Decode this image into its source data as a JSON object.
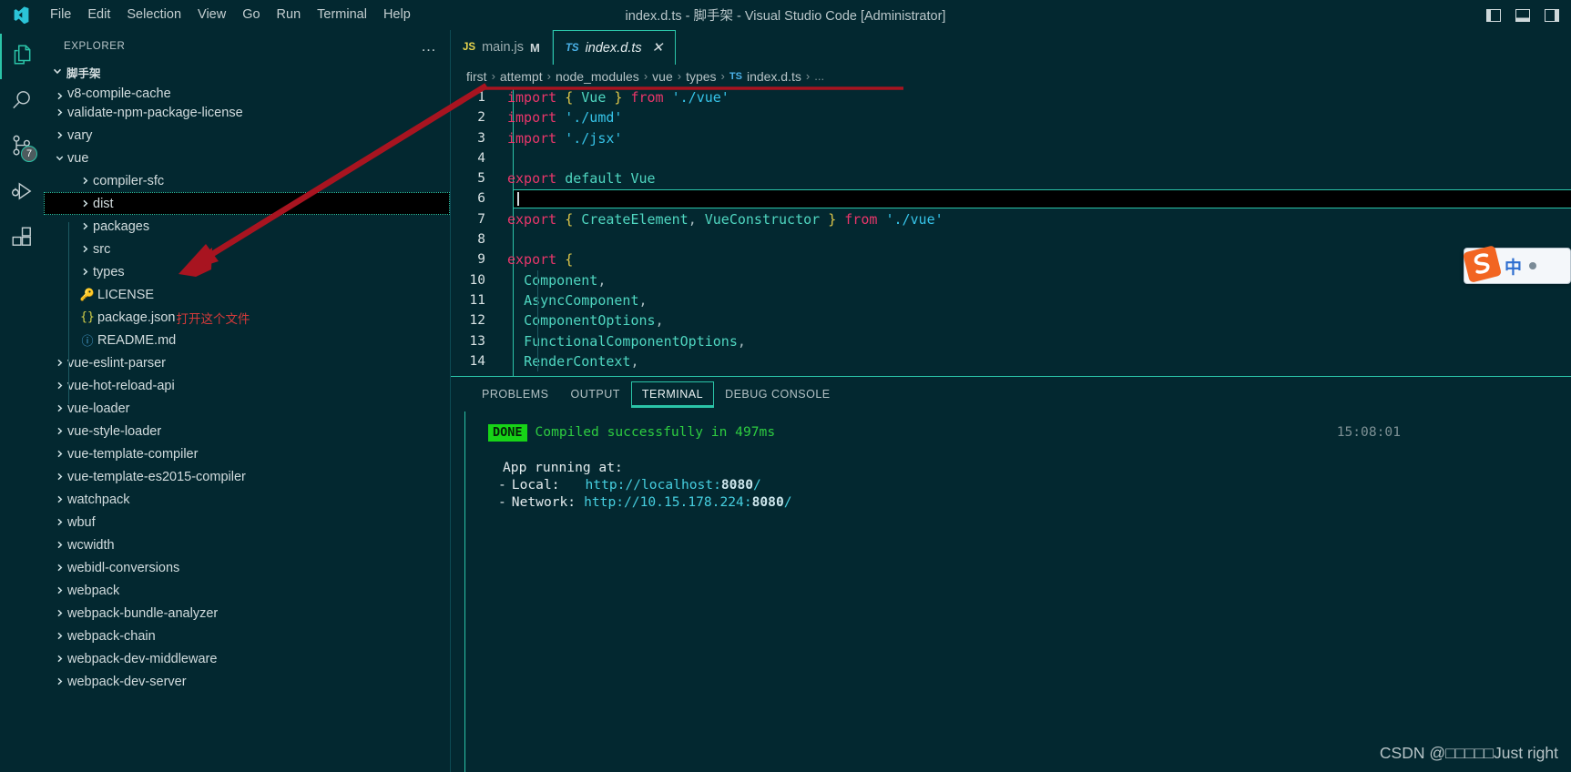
{
  "window": {
    "title": "index.d.ts - 脚手架 - Visual Studio Code [Administrator]",
    "logo_name": "vscode-logo"
  },
  "menubar": {
    "items": [
      "File",
      "Edit",
      "Selection",
      "View",
      "Go",
      "Run",
      "Terminal",
      "Help"
    ]
  },
  "window_controls": {
    "restore": "restore-window",
    "minimize": "minimize-window",
    "maximize": "maximize-window"
  },
  "activitybar": {
    "items": [
      {
        "name": "explorer",
        "icon": "files-icon",
        "active": true,
        "badge": ""
      },
      {
        "name": "search",
        "icon": "search-icon",
        "active": false,
        "badge": ""
      },
      {
        "name": "source-control",
        "icon": "source-control-icon",
        "active": false,
        "badge": "7"
      },
      {
        "name": "run-and-debug",
        "icon": "run-debug-icon",
        "active": false,
        "badge": ""
      },
      {
        "name": "extensions",
        "icon": "extensions-icon",
        "active": false,
        "badge": ""
      }
    ]
  },
  "sidebar": {
    "title": "EXPLORER",
    "more_actions": "…",
    "root_folder": "脚手架",
    "tree": [
      {
        "label": "v8-compile-cache",
        "type": "folder",
        "expanded": false,
        "depth": 1,
        "clipped": true
      },
      {
        "label": "validate-npm-package-license",
        "type": "folder",
        "expanded": false,
        "depth": 1
      },
      {
        "label": "vary",
        "type": "folder",
        "expanded": false,
        "depth": 1
      },
      {
        "label": "vue",
        "type": "folder",
        "expanded": true,
        "depth": 1
      },
      {
        "label": "compiler-sfc",
        "type": "folder",
        "expanded": false,
        "depth": 2
      },
      {
        "label": "dist",
        "type": "folder",
        "expanded": false,
        "depth": 2,
        "selected": true
      },
      {
        "label": "packages",
        "type": "folder",
        "expanded": false,
        "depth": 2
      },
      {
        "label": "src",
        "type": "folder",
        "expanded": false,
        "depth": 2
      },
      {
        "label": "types",
        "type": "folder",
        "expanded": false,
        "depth": 2
      },
      {
        "label": "LICENSE",
        "type": "file",
        "icon": "license-icon",
        "depth": 2
      },
      {
        "label": "package.json",
        "type": "file",
        "icon": "json-icon",
        "depth": 2,
        "note": "打开这个文件"
      },
      {
        "label": "README.md",
        "type": "file",
        "icon": "info-icon",
        "depth": 2
      },
      {
        "label": "vue-eslint-parser",
        "type": "folder",
        "expanded": false,
        "depth": 1
      },
      {
        "label": "vue-hot-reload-api",
        "type": "folder",
        "expanded": false,
        "depth": 1
      },
      {
        "label": "vue-loader",
        "type": "folder",
        "expanded": false,
        "depth": 1
      },
      {
        "label": "vue-style-loader",
        "type": "folder",
        "expanded": false,
        "depth": 1
      },
      {
        "label": "vue-template-compiler",
        "type": "folder",
        "expanded": false,
        "depth": 1
      },
      {
        "label": "vue-template-es2015-compiler",
        "type": "folder",
        "expanded": false,
        "depth": 1
      },
      {
        "label": "watchpack",
        "type": "folder",
        "expanded": false,
        "depth": 1
      },
      {
        "label": "wbuf",
        "type": "folder",
        "expanded": false,
        "depth": 1
      },
      {
        "label": "wcwidth",
        "type": "folder",
        "expanded": false,
        "depth": 1
      },
      {
        "label": "webidl-conversions",
        "type": "folder",
        "expanded": false,
        "depth": 1
      },
      {
        "label": "webpack",
        "type": "folder",
        "expanded": false,
        "depth": 1
      },
      {
        "label": "webpack-bundle-analyzer",
        "type": "folder",
        "expanded": false,
        "depth": 1
      },
      {
        "label": "webpack-chain",
        "type": "folder",
        "expanded": false,
        "depth": 1
      },
      {
        "label": "webpack-dev-middleware",
        "type": "folder",
        "expanded": false,
        "depth": 1
      },
      {
        "label": "webpack-dev-server",
        "type": "folder",
        "expanded": false,
        "depth": 1
      }
    ]
  },
  "editor": {
    "tabs": [
      {
        "label": "main.js",
        "filetype": "JS",
        "dirty": "M",
        "active": false,
        "closable": false
      },
      {
        "label": "index.d.ts",
        "filetype": "TS",
        "dirty": "",
        "active": true,
        "closable": true,
        "close_label": "✕"
      }
    ],
    "breadcrumb": {
      "separator": "›",
      "items": [
        "first",
        "attempt",
        "node_modules",
        "vue",
        "types"
      ],
      "file": "index.d.ts",
      "file_type": "TS",
      "trailing": "..."
    },
    "lines": [
      {
        "n": "1",
        "tokens": [
          [
            "k-import",
            "import"
          ],
          [
            "k-punc",
            " "
          ],
          [
            "k-brace",
            "{"
          ],
          [
            "k-punc",
            " "
          ],
          [
            "k-id",
            "Vue"
          ],
          [
            "k-punc",
            " "
          ],
          [
            "k-brace",
            "}"
          ],
          [
            "k-punc",
            " "
          ],
          [
            "k-kw",
            "from"
          ],
          [
            "k-punc",
            " "
          ],
          [
            "k-str",
            "'./vue'"
          ]
        ]
      },
      {
        "n": "2",
        "tokens": [
          [
            "k-import",
            "import"
          ],
          [
            "k-punc",
            " "
          ],
          [
            "k-str",
            "'./umd'"
          ]
        ]
      },
      {
        "n": "3",
        "tokens": [
          [
            "k-import",
            "import"
          ],
          [
            "k-punc",
            " "
          ],
          [
            "k-str",
            "'./jsx'"
          ]
        ]
      },
      {
        "n": "4",
        "tokens": []
      },
      {
        "n": "5",
        "tokens": [
          [
            "k-kw",
            "export"
          ],
          [
            "k-punc",
            " "
          ],
          [
            "k-def",
            "default"
          ],
          [
            "k-punc",
            " "
          ],
          [
            "k-id",
            "Vue"
          ]
        ]
      },
      {
        "n": "6",
        "tokens": [],
        "cursor": true
      },
      {
        "n": "7",
        "tokens": [
          [
            "k-kw",
            "export"
          ],
          [
            "k-punc",
            " "
          ],
          [
            "k-brace",
            "{"
          ],
          [
            "k-punc",
            " "
          ],
          [
            "k-id",
            "CreateElement"
          ],
          [
            "k-punc",
            ", "
          ],
          [
            "k-id",
            "VueConstructor"
          ],
          [
            "k-punc",
            " "
          ],
          [
            "k-brace",
            "}"
          ],
          [
            "k-punc",
            " "
          ],
          [
            "k-kw",
            "from"
          ],
          [
            "k-punc",
            " "
          ],
          [
            "k-str",
            "'./vue'"
          ]
        ]
      },
      {
        "n": "8",
        "tokens": []
      },
      {
        "n": "9",
        "tokens": [
          [
            "k-kw",
            "export"
          ],
          [
            "k-punc",
            " "
          ],
          [
            "k-brace",
            "{"
          ]
        ]
      },
      {
        "n": "10",
        "tokens": [
          [
            "k-punc",
            "  "
          ],
          [
            "k-id",
            "Component"
          ],
          [
            "k-punc",
            ","
          ]
        ]
      },
      {
        "n": "11",
        "tokens": [
          [
            "k-punc",
            "  "
          ],
          [
            "k-id",
            "AsyncComponent"
          ],
          [
            "k-punc",
            ","
          ]
        ]
      },
      {
        "n": "12",
        "tokens": [
          [
            "k-punc",
            "  "
          ],
          [
            "k-id",
            "ComponentOptions"
          ],
          [
            "k-punc",
            ","
          ]
        ]
      },
      {
        "n": "13",
        "tokens": [
          [
            "k-punc",
            "  "
          ],
          [
            "k-id",
            "FunctionalComponentOptions"
          ],
          [
            "k-punc",
            ","
          ]
        ]
      },
      {
        "n": "14",
        "tokens": [
          [
            "k-punc",
            "  "
          ],
          [
            "k-id",
            "RenderContext"
          ],
          [
            "k-punc",
            ","
          ]
        ]
      }
    ]
  },
  "panel": {
    "tabs": [
      {
        "label": "PROBLEMS",
        "active": false
      },
      {
        "label": "OUTPUT",
        "active": false
      },
      {
        "label": "TERMINAL",
        "active": true
      },
      {
        "label": "DEBUG CONSOLE",
        "active": false
      }
    ],
    "terminal": {
      "badge": "DONE",
      "status_text": "Compiled successfully in 497ms",
      "timestamp": "15:08:01",
      "heading": "App running at:",
      "entries": [
        {
          "dash": "-",
          "label": "Local:",
          "pad": "   ",
          "url_prefix": "http://localhost:",
          "port": "8080",
          "url_suffix": "/"
        },
        {
          "dash": "-",
          "label": "Network:",
          "pad": " ",
          "url_prefix": "http://10.15.178.224:",
          "port": "8080",
          "url_suffix": "/"
        }
      ]
    }
  },
  "annotation": {
    "arrow_name": "red-arrow-annotation",
    "underline_name": "red-underline-annotation",
    "color": "#a81420"
  },
  "ime": {
    "logo_name": "sogou-ime-logo",
    "mode": "中",
    "dot_name": "ime-status-dot"
  },
  "watermark": {
    "prefix": "CSDN @",
    "cjk": "□□□□□",
    "suffix": "Just right"
  },
  "colors": {
    "background": "#032830",
    "accent": "#2bc4a8",
    "annotation_red": "#a81420",
    "keyword_pink": "#e8366a",
    "identifier_teal": "#4fd6c0",
    "string_cyan": "#36c3e8",
    "brace_yellow": "#e0c84a",
    "terminal_green": "#2ecc40",
    "done_badge_green": "#17d417"
  }
}
